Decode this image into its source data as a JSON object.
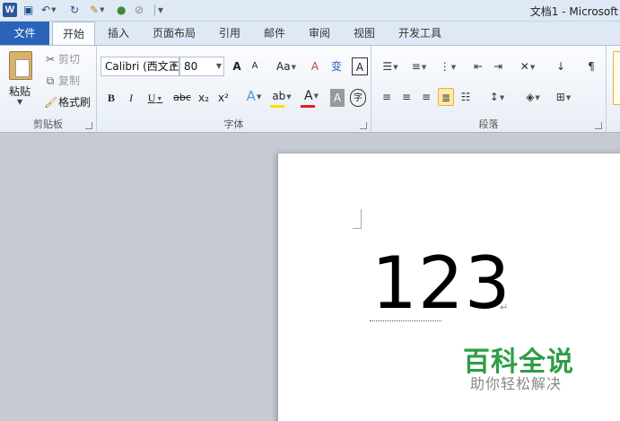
{
  "window": {
    "title": "文档1 - Microsoft"
  },
  "qat": {
    "app_icon": "W"
  },
  "tabs": {
    "file": "文件",
    "items": [
      "开始",
      "插入",
      "页面布局",
      "引用",
      "邮件",
      "审阅",
      "视图",
      "开发工具"
    ],
    "active_index": 0
  },
  "clipboard": {
    "paste": "粘贴",
    "cut": "剪切",
    "copy": "复制",
    "format_painter": "格式刷",
    "group_label": "剪贴板"
  },
  "font": {
    "name_value": "Calibri (西文正",
    "size_value": "80",
    "grow": "A",
    "shrink": "A",
    "change_case": "Aa",
    "clear_format": "A",
    "bold": "B",
    "italic": "I",
    "underline": "U",
    "strikethrough": "abc",
    "subscript": "x₂",
    "superscript": "x²",
    "text_effects": "A",
    "highlight": "ab",
    "font_color": "A",
    "char_shading": "A",
    "enclose": "字",
    "phonetic": "变",
    "char_border": "A",
    "group_label": "字体",
    "highlight_color": "#f2e600",
    "font_color_bar": "#e02020"
  },
  "paragraph": {
    "group_label": "段落"
  },
  "document": {
    "text": "123",
    "para_mark": "↵"
  },
  "watermark": {
    "title": "百科全说",
    "subtitle": "助你轻松解决",
    "color": "#2f9e44"
  }
}
